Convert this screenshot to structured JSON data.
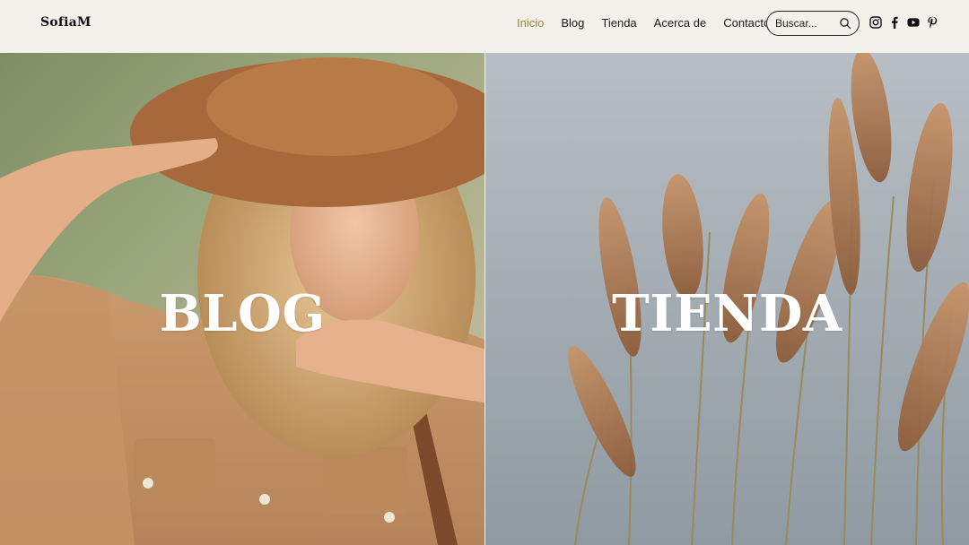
{
  "site": {
    "logo": "SofiaM"
  },
  "nav": {
    "items": [
      {
        "label": "Inicio",
        "active": true
      },
      {
        "label": "Blog",
        "active": false
      },
      {
        "label": "Tienda",
        "active": false
      },
      {
        "label": "Acerca de",
        "active": false
      },
      {
        "label": "Contacto",
        "active": false
      }
    ]
  },
  "search": {
    "placeholder": "Buscar...",
    "value": "",
    "icon": "search-icon"
  },
  "social": [
    {
      "icon": "instagram-icon"
    },
    {
      "icon": "facebook-icon"
    },
    {
      "icon": "youtube-icon"
    },
    {
      "icon": "pinterest-icon"
    }
  ],
  "panels": {
    "left": {
      "title": "BLOG"
    },
    "right": {
      "title": "TIENDA"
    }
  },
  "colors": {
    "background": "#f3f1ec",
    "active_nav": "#a0842f",
    "text": "#111111",
    "panel_title": "#ffffff"
  }
}
